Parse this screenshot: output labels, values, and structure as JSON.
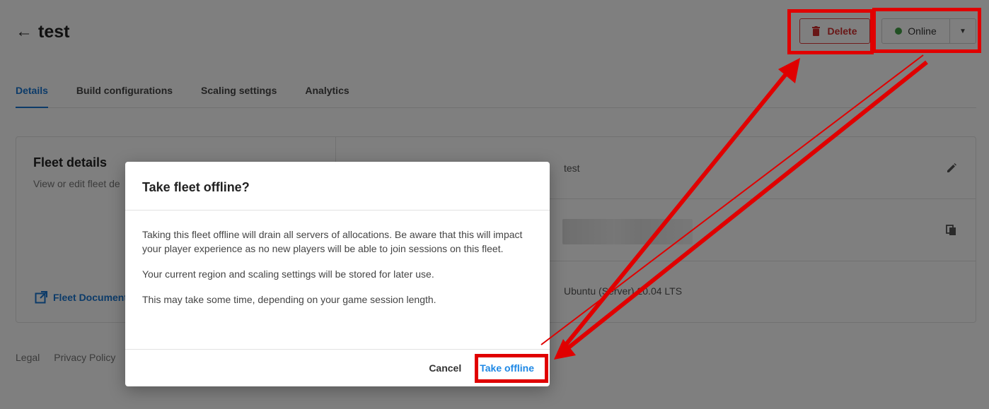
{
  "header": {
    "back_arrow": "←",
    "title": "test"
  },
  "actions": {
    "delete_label": "Delete",
    "status_label": "Online",
    "status_color": "#43a047",
    "caret": "▼"
  },
  "tabs": [
    {
      "label": "Details",
      "active": true
    },
    {
      "label": "Build configurations",
      "active": false
    },
    {
      "label": "Scaling settings",
      "active": false
    },
    {
      "label": "Analytics",
      "active": false
    }
  ],
  "card": {
    "title": "Fleet details",
    "subtitle": "View or edit fleet de",
    "doc_link": "Fleet Document",
    "rows": [
      {
        "value": "test",
        "icon": "pencil-icon"
      },
      {
        "value": "",
        "icon": "copy-icon"
      },
      {
        "value": "Ubuntu (Server) 20.04 LTS",
        "icon": ""
      }
    ]
  },
  "footer": {
    "links": [
      "Legal",
      "Privacy Policy"
    ]
  },
  "modal": {
    "title": "Take fleet offline?",
    "paragraphs": [
      "Taking this fleet offline will drain all servers of allocations. Be aware that this will impact your player experience as no new players will be able to join sessions on this fleet.",
      "Your current region and scaling settings will be stored for later use.",
      "This may take some time, depending on your game session length."
    ],
    "cancel_label": "Cancel",
    "confirm_label": "Take offline"
  },
  "colors": {
    "accent": "#1976d2",
    "danger": "#d32f2f",
    "annotation": "#e00000"
  }
}
